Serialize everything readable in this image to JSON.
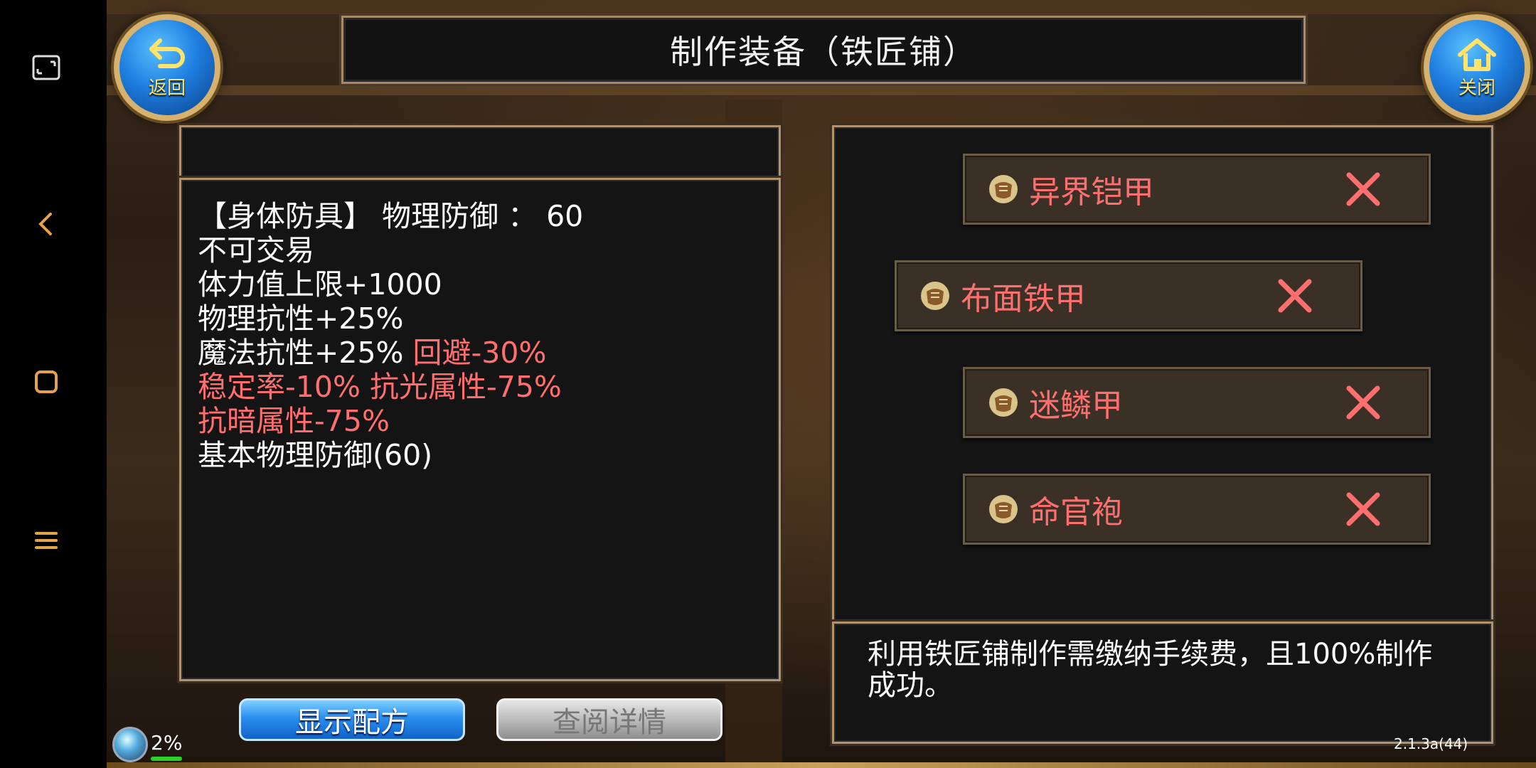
{
  "window": {
    "title": "制作装备（铁匠铺）"
  },
  "buttons": {
    "back_label": "返回",
    "close_label": "关闭",
    "show_recipe": "显示配方",
    "view_details": "查阅详情"
  },
  "item_stats": {
    "line1": "【身体防具】 物理防御 ：  60",
    "line2": "不可交易",
    "line3": "体力值上限+1000",
    "line4": "物理抗性+25%",
    "line5_white": "魔法抗性+25% ",
    "line5_red": "回避-30%",
    "line6": "稳定率-10% 抗光属性-75%",
    "line7": "抗暗属性-75%",
    "line8": "基本物理防御(60)"
  },
  "recipes": [
    {
      "name": "异界铠甲",
      "icon": "armor-icon"
    },
    {
      "name": "布面铁甲",
      "icon": "armor-icon"
    },
    {
      "name": "迷鳞甲",
      "icon": "armor-icon"
    },
    {
      "name": "命官袍",
      "icon": "armor-icon"
    }
  ],
  "note": "利用铁匠铺制作需缴纳手续费，且100%制作成功。",
  "hud": {
    "percent": "2%",
    "version": "2.1.3a(44)"
  },
  "colors": {
    "accent_red": "#ff6f6f",
    "frame": "#b09270",
    "button_blue": "#2a8ff0"
  }
}
